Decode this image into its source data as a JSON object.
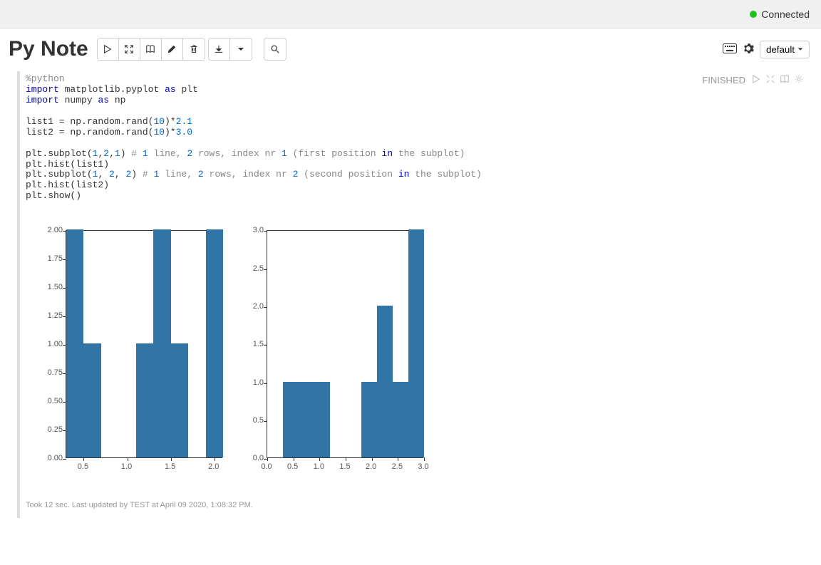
{
  "connection": {
    "status_label": "Connected"
  },
  "header": {
    "title": "Py Note",
    "mode_label": "default"
  },
  "code": {
    "line1_magic": "%python",
    "line2_kw_import": "import",
    "line2_mod": "matplotlib.pyplot",
    "line2_kw_as": "as",
    "line2_alias": "plt",
    "line3_kw_import": "import",
    "line3_mod": "numpy",
    "line3_kw_as": "as",
    "line3_alias": "np",
    "line5_pre": "list1 = np.random.rand(",
    "line5_n": "10",
    "line5_mid": ")*",
    "line5_k": "2.1",
    "line6_pre": "list2 = np.random.rand(",
    "line6_n": "10",
    "line6_mid": ")*",
    "line6_k": "3.0",
    "line8_pre": "plt.subplot(",
    "line8_a": "1",
    "line8_c1": ",",
    "line8_b": "2",
    "line8_c2": ",",
    "line8_c": "1",
    "line8_post": ")",
    "line8_h1": " # ",
    "line8_h2": "1",
    "line8_h3": " line, ",
    "line8_h4": "2",
    "line8_h5": " rows, index nr ",
    "line8_h6": "1",
    "line8_h7": " (first position ",
    "line8_h_in": "in",
    "line8_h8": " the subplot)",
    "line9": "plt.hist(list1)",
    "line10_pre": "plt.subplot(",
    "line10_a": "1",
    "line10_c1": ", ",
    "line10_b": "2",
    "line10_c2": ", ",
    "line10_c": "2",
    "line10_post": ")",
    "line10_h1": " # ",
    "line10_h2": "1",
    "line10_h3": " line, ",
    "line10_h4": "2",
    "line10_h5": " rows, index nr ",
    "line10_h6": "2",
    "line10_h7": " (second position ",
    "line10_h_in": "in",
    "line10_h8": " the subplot)",
    "line11": "plt.hist(list2)",
    "line12": "plt.show()"
  },
  "paragraph": {
    "status_label": "FINISHED",
    "footer": "Took 12 sec. Last updated by TEST at April 09 2020, 1:08:32 PM."
  },
  "chart_data": [
    {
      "type": "bar",
      "subplot_index": 1,
      "bin_edges": [
        0.3,
        0.5,
        0.7,
        0.9,
        1.1,
        1.3,
        1.5,
        1.7,
        1.9,
        2.1
      ],
      "bin_centers_approx": [
        0.4,
        0.6,
        0.8,
        1.0,
        1.2,
        1.4,
        1.6,
        1.8,
        2.0
      ],
      "values": [
        2.0,
        1.0,
        0.0,
        0.0,
        1.0,
        2.0,
        1.0,
        0.0,
        2.0
      ],
      "x_ticks": [
        0.5,
        1.0,
        1.5,
        2.0
      ],
      "y_ticks": [
        0.0,
        0.25,
        0.5,
        0.75,
        1.0,
        1.25,
        1.5,
        1.75,
        2.0
      ],
      "xlim": [
        0.3,
        2.1
      ],
      "ylim": [
        0.0,
        2.0
      ]
    },
    {
      "type": "bar",
      "subplot_index": 2,
      "bin_edges": [
        0.0,
        0.3,
        0.6,
        0.9,
        1.2,
        1.5,
        1.8,
        2.1,
        2.4,
        2.7,
        3.0
      ],
      "bin_centers_approx": [
        0.15,
        0.45,
        0.75,
        1.05,
        1.35,
        1.65,
        1.95,
        2.25,
        2.55,
        2.85
      ],
      "values": [
        0.0,
        1.0,
        1.0,
        1.0,
        0.0,
        0.0,
        1.0,
        2.0,
        1.0,
        3.0
      ],
      "x_ticks": [
        0.0,
        0.5,
        1.0,
        1.5,
        2.0,
        2.5,
        3.0
      ],
      "y_ticks": [
        0.0,
        0.5,
        1.0,
        1.5,
        2.0,
        2.5,
        3.0
      ],
      "xlim": [
        0.0,
        3.0
      ],
      "ylim": [
        0.0,
        3.0
      ]
    }
  ]
}
